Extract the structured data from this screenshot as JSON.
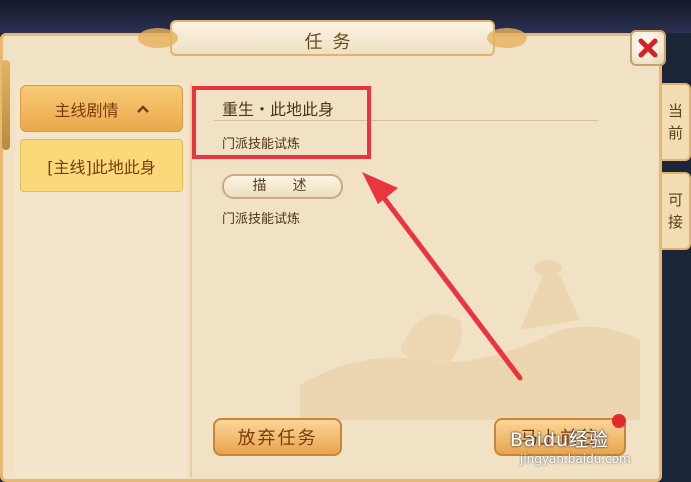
{
  "window": {
    "title": "任务"
  },
  "side_tabs": [
    {
      "label_line1": "当",
      "label_line2": "前"
    },
    {
      "label_line1": "可",
      "label_line2": "接"
    }
  ],
  "category": {
    "label": "主线剧情",
    "chevron": "chevron-up-icon"
  },
  "quest_list": [
    {
      "label": "[主线]此地此身"
    }
  ],
  "quest_detail": {
    "title": "重生・此地此身",
    "subtitle": "门派技能试炼",
    "desc_label": "描　述",
    "desc_text": "门派技能试炼"
  },
  "buttons": {
    "abandon": "放弃任务",
    "go": "马上前往"
  },
  "watermark": {
    "brand": "Baidu经验",
    "url": "jingyan.baidu.com"
  },
  "colors": {
    "highlight_box": "#e8353f",
    "annotation_arrow": "#e8353f",
    "button_gold": "#e8a44d"
  }
}
